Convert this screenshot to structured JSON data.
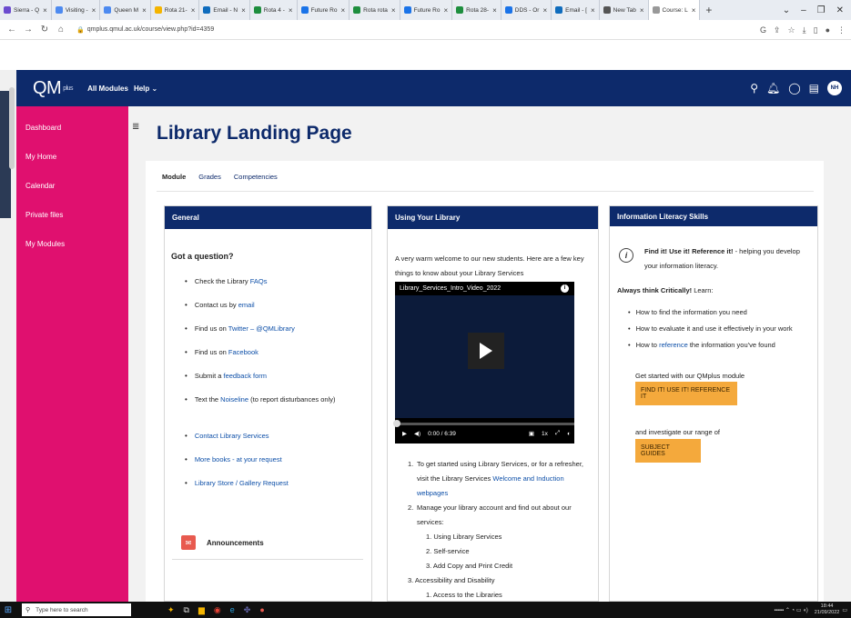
{
  "browser": {
    "tabs": [
      {
        "label": "Sierra - Q",
        "color": "#6b4bcf"
      },
      {
        "label": "Visiting -",
        "color": "#4d8af0"
      },
      {
        "label": "Queen M",
        "color": "#4d8af0"
      },
      {
        "label": "Rota 21-",
        "color": "#f4b400"
      },
      {
        "label": "Email - N",
        "color": "#0f6cbd"
      },
      {
        "label": "Rota 4 -",
        "color": "#1e8e3e"
      },
      {
        "label": "Future Ro",
        "color": "#1a73e8"
      },
      {
        "label": "Rota rota",
        "color": "#1e8e3e"
      },
      {
        "label": "Future Ro",
        "color": "#1a73e8"
      },
      {
        "label": "Rota 28-",
        "color": "#1e8e3e"
      },
      {
        "label": "DDS - Or",
        "color": "#1a73e8"
      },
      {
        "label": "Email - [",
        "color": "#0f6cbd"
      },
      {
        "label": "New Tab",
        "color": "#555555"
      },
      {
        "label": "Course: L",
        "color": "#999999"
      }
    ],
    "url": "qmplus.qmul.ac.uk/course/view.php?id=4359"
  },
  "header": {
    "logo_main": "QM",
    "logo_small": "plus",
    "nav_modules": "All Modules",
    "nav_help": "Help ⌄",
    "avatar": "NH"
  },
  "drawer": {
    "items": [
      "Dashboard",
      "My Home",
      "Calendar",
      "Private files",
      "My Modules"
    ]
  },
  "page": {
    "title": "Library Landing Page",
    "tabs": [
      "Module",
      "Grades",
      "Competencies"
    ]
  },
  "general": {
    "heading": "General",
    "question": "Got a question?",
    "list": [
      {
        "pre": "Check the Library ",
        "link": "FAQs",
        "post": ""
      },
      {
        "pre": "Contact us by ",
        "link": "email",
        "post": ""
      },
      {
        "pre": "Find us on ",
        "link": "Twitter – @QMLibrary",
        "post": ""
      },
      {
        "pre": "Find us on ",
        "link": "Facebook",
        "post": ""
      },
      {
        "pre": "Submit a ",
        "link": "feedback form",
        "post": ""
      },
      {
        "pre": "Text the ",
        "link": "Noiseline",
        "post": " (to report disturbances only)"
      }
    ],
    "list2": [
      "Contact Library Services",
      "More books - at your request",
      "Library Store / Gallery Request"
    ],
    "announcements": "Announcements"
  },
  "using": {
    "heading": "Using Your Library",
    "welcome": "A very warm welcome to our new students. Here are a few key things to know about your Library Services",
    "video_title": "Library_Services_Intro_Video_2022",
    "video_time": "0:00 / 6:39",
    "video_speed": "1x",
    "steps": [
      {
        "num": "1.",
        "pre": "To get started using Library Services, or for a refresher, visit the Library Services ",
        "link": "Welcome and Induction webpages"
      },
      {
        "num": "2.",
        "pre": "Manage your library account and find out about our services:",
        "link": ""
      }
    ],
    "sub_steps": [
      "1. Using Library Services",
      "2. Self-service",
      "3. Add Copy and Print Credit"
    ],
    "step3": "3. Accessibility and Disability",
    "step3_sub": "1. Access to the Libraries"
  },
  "literacy": {
    "heading": "Information Literacy Skills",
    "fiu_bold": "Find it! Use it! Reference it!",
    "fiu_rest": " - helping you develop your information literacy.",
    "think_bold": "Always think Critically!",
    "think_rest": " Learn:",
    "list": [
      {
        "pre": "How to find the information you need",
        "link": "",
        "post": ""
      },
      {
        "pre": "How to evaluate it and use it effectively in your work",
        "link": "",
        "post": ""
      },
      {
        "pre": "How to ",
        "link": "reference",
        "post": " the information you've found"
      }
    ],
    "started": "Get started with our QMplus module",
    "btn_module": "FIND IT! USE IT! REFERENCE IT",
    "investigate": "and investigate our range of",
    "btn_guides": "SUBJECT GUIDES"
  },
  "taskbar": {
    "search_placeholder": "Type here to search",
    "time": "18:44",
    "date": "21/09/2022"
  }
}
